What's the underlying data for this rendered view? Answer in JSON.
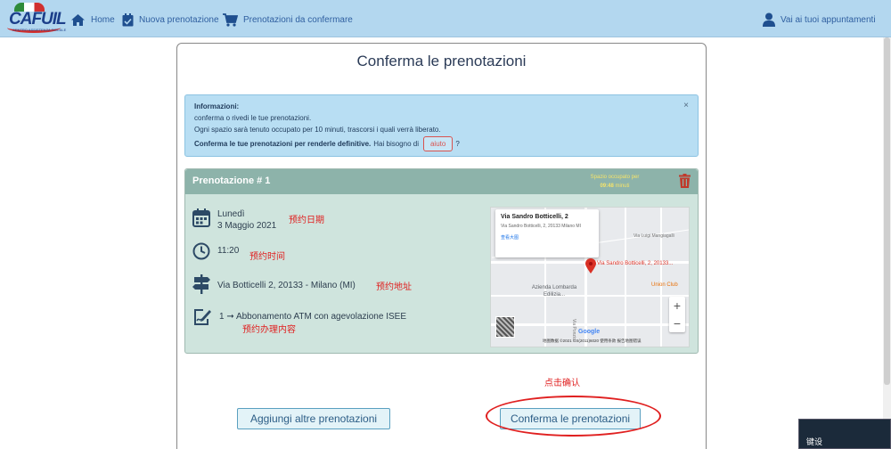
{
  "navbar": {
    "logo_text": "CAFUIL",
    "logo_sub": "CENTRO ASSISTENZA FISCALE",
    "home": "Home",
    "new_booking": "Nuova prenotazione",
    "to_confirm": "Prenotazioni da confermare",
    "appointments": "Vai ai tuoi appuntamenti"
  },
  "page": {
    "title": "Conferma le prenotazioni"
  },
  "alert": {
    "heading": "Informazioni:",
    "line1": "conferma o rivedi le tue prenotazioni.",
    "line2": "Ogni spazio sarà tenuto occupato per 10 minuti, trascorsi i quali verrà liberato.",
    "bold_text": "Conferma le tue prenotazioni per renderle definitive.",
    "help_question": "Hai bisogno di",
    "help_button": "aiuto",
    "question_mark": "?",
    "close": "×"
  },
  "booking": {
    "title": "Prenotazione # 1",
    "occupied_label": "Spazio occupato per",
    "occupied_time": "09:48",
    "occupied_unit": "minuti",
    "day": "Lunedì",
    "date": "3 Maggio 2021",
    "time": "11:20",
    "address": "Via Botticelli 2, 20133 - Milano (MI)",
    "service": "1 ➞ Abbonamento ATM con agevolazione ISEE"
  },
  "annotations": {
    "date_note": "预约日期",
    "time_note": "预约时间",
    "address_note": "预约地址",
    "service_note": "预约办理内容",
    "click_note": "点击确认"
  },
  "map": {
    "popup_title": "Via Sandro Botticelli, 2",
    "popup_address": "Via Sandro Botticelli, 2, 20133 Milano MI",
    "popup_link": "查看大图",
    "pin_label": "Via Sandro Botticelli, 2, 20133...",
    "poi_union": "Union Club",
    "poi_azienda": "Azienda Lombarda Edilizia...",
    "street_luigi": "Via Luigi Mangiagalli",
    "street_ponzio": "Via Ponzio",
    "google": "Google",
    "footer": "地图数据 ©2021 GS(2011)6020   使用条款   报告地图错误"
  },
  "buttons": {
    "add": "Aggiungi altre prenotazioni",
    "confirm": "Conferma le prenotazioni"
  },
  "ime": {
    "text": "键设"
  }
}
